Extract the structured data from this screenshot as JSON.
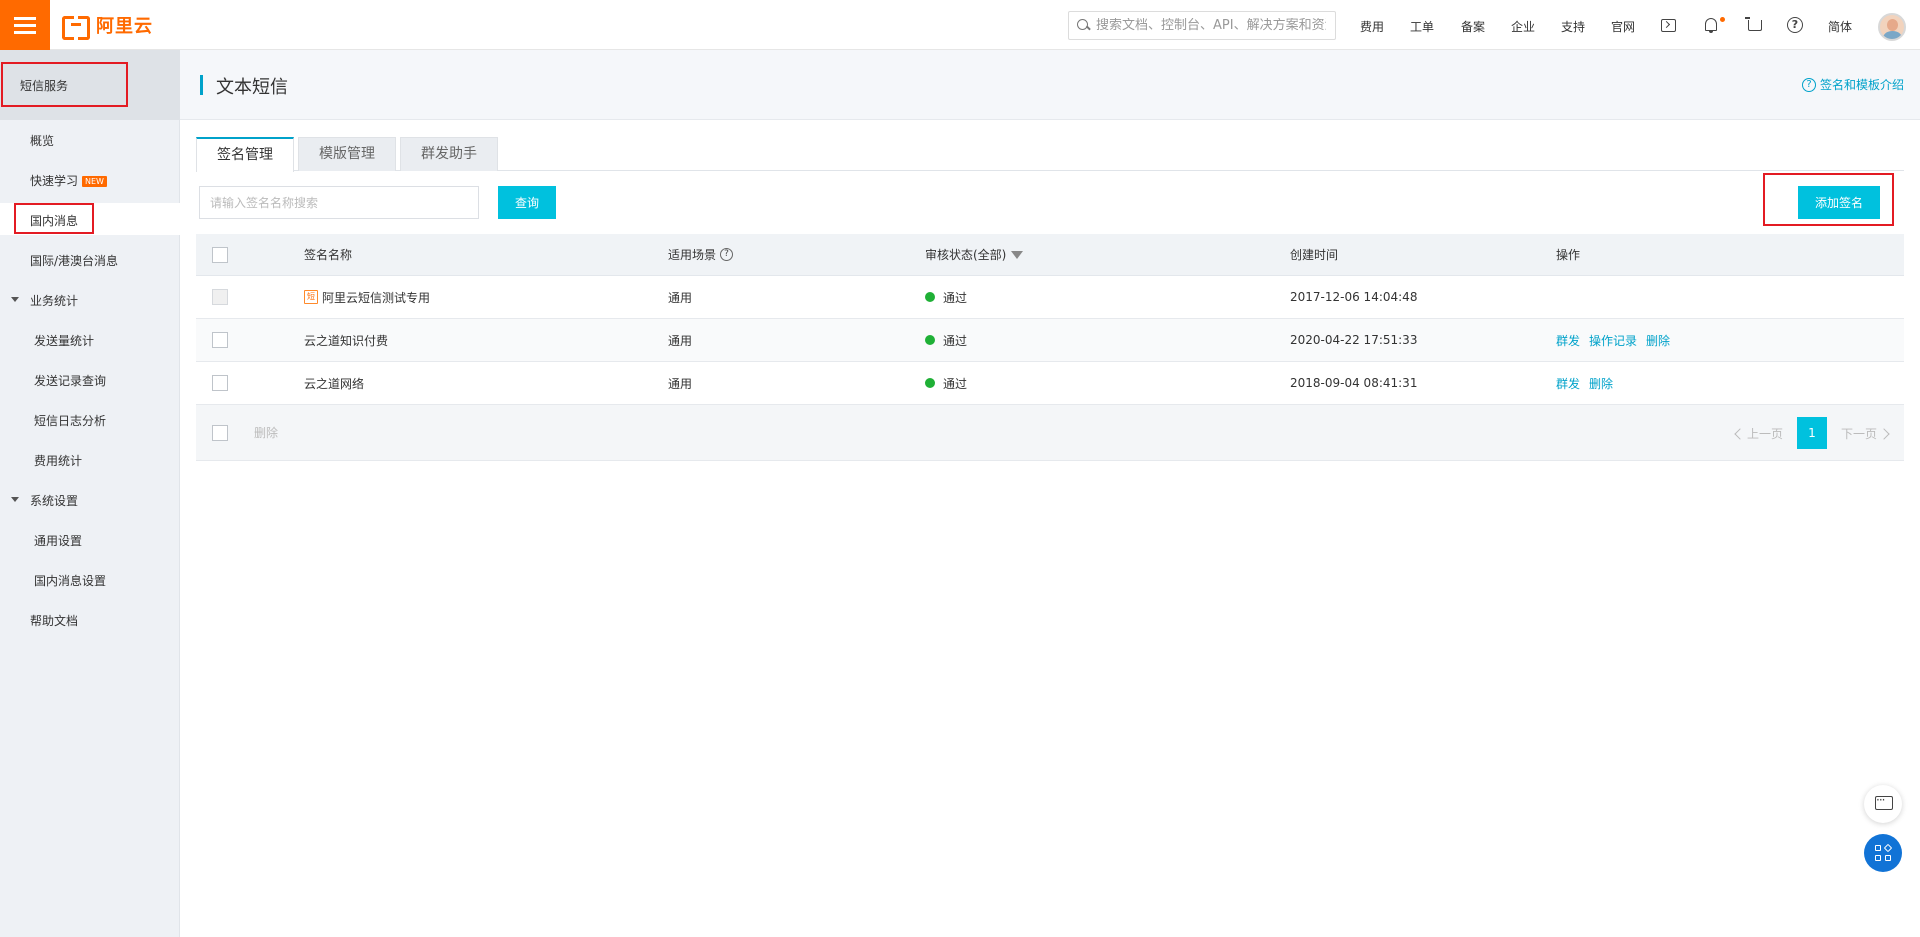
{
  "topbar": {
    "logo_text": "阿里云",
    "search_placeholder": "搜索文档、控制台、API、解决方案和资源",
    "nav": [
      "费用",
      "工单",
      "备案",
      "企业",
      "支持",
      "官网"
    ],
    "lang": "简体",
    "icons": [
      "terminal-icon",
      "bell-icon",
      "cart-icon",
      "help-icon"
    ]
  },
  "sidebar": {
    "header": "短信服务",
    "items": [
      {
        "label": "概览"
      },
      {
        "label": "快速学习",
        "badge": "NEW"
      },
      {
        "label": "国内消息"
      },
      {
        "label": "国际/港澳台消息"
      },
      {
        "label": "业务统计"
      },
      {
        "label": "发送量统计"
      },
      {
        "label": "发送记录查询"
      },
      {
        "label": "短信日志分析"
      },
      {
        "label": "费用统计"
      },
      {
        "label": "系统设置"
      },
      {
        "label": "通用设置"
      },
      {
        "label": "国内消息设置"
      },
      {
        "label": "帮助文档"
      }
    ]
  },
  "main": {
    "title": "文本短信",
    "intro_link": "签名和模板介绍",
    "tabs": [
      "签名管理",
      "模版管理",
      "群发助手"
    ],
    "search_placeholder": "请输入签名名称搜索",
    "query_button": "查询",
    "add_button": "添加签名",
    "columns": [
      "签名名称",
      "适用场景",
      "审核状态(全部)",
      "创建时间",
      "操作"
    ],
    "rows": [
      {
        "name": "阿里云短信测试专用",
        "tag": "短",
        "scene": "通用",
        "status": "通过",
        "created": "2017-12-06 14:04:48",
        "actions": []
      },
      {
        "name": "云之道知识付费",
        "scene": "通用",
        "status": "通过",
        "created": "2020-04-22 17:51:33",
        "actions": [
          "群发",
          "操作记录",
          "删除"
        ]
      },
      {
        "name": "云之道网络",
        "scene": "通用",
        "status": "通过",
        "created": "2018-09-04 08:41:31",
        "actions": [
          "群发",
          "删除"
        ]
      }
    ],
    "bulk_delete": "删除",
    "pager": {
      "prev": "上一页",
      "current": "1",
      "next": "下一页"
    }
  },
  "colors": {
    "accent": "#00c1de",
    "brand": "#ff6a00",
    "success": "#1fb036",
    "highlight": "#e31b23"
  }
}
